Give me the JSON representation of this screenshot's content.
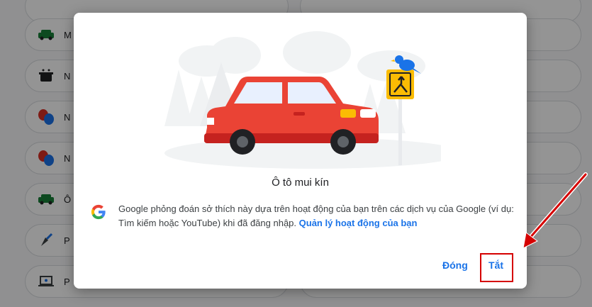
{
  "background": {
    "left_items": [
      {
        "icon": "car-icon",
        "label": "M"
      },
      {
        "icon": "pot-icon",
        "label": "N"
      },
      {
        "icon": "theater-masks-icon",
        "label": "N"
      },
      {
        "icon": "theater-masks-icon",
        "label": "N"
      },
      {
        "icon": "car-icon",
        "label": "Ô"
      },
      {
        "icon": "pen-icon",
        "label": "P"
      },
      {
        "icon": "laptop-icon",
        "label": "P"
      }
    ]
  },
  "dialog": {
    "title": "Ô tô mui kín",
    "description": "Google phỏng đoán sở thích này dựa trên hoạt động của bạn trên các dịch vụ của Google (ví dụ: Tìm kiếm hoặc YouTube) khi đã đăng nhập.",
    "link": "Quản lý hoạt động của bạn",
    "close_label": "Đóng",
    "off_label": "Tắt"
  },
  "colors": {
    "accent": "#1a73e8",
    "car": "#ea4335",
    "highlight": "#d50000"
  }
}
